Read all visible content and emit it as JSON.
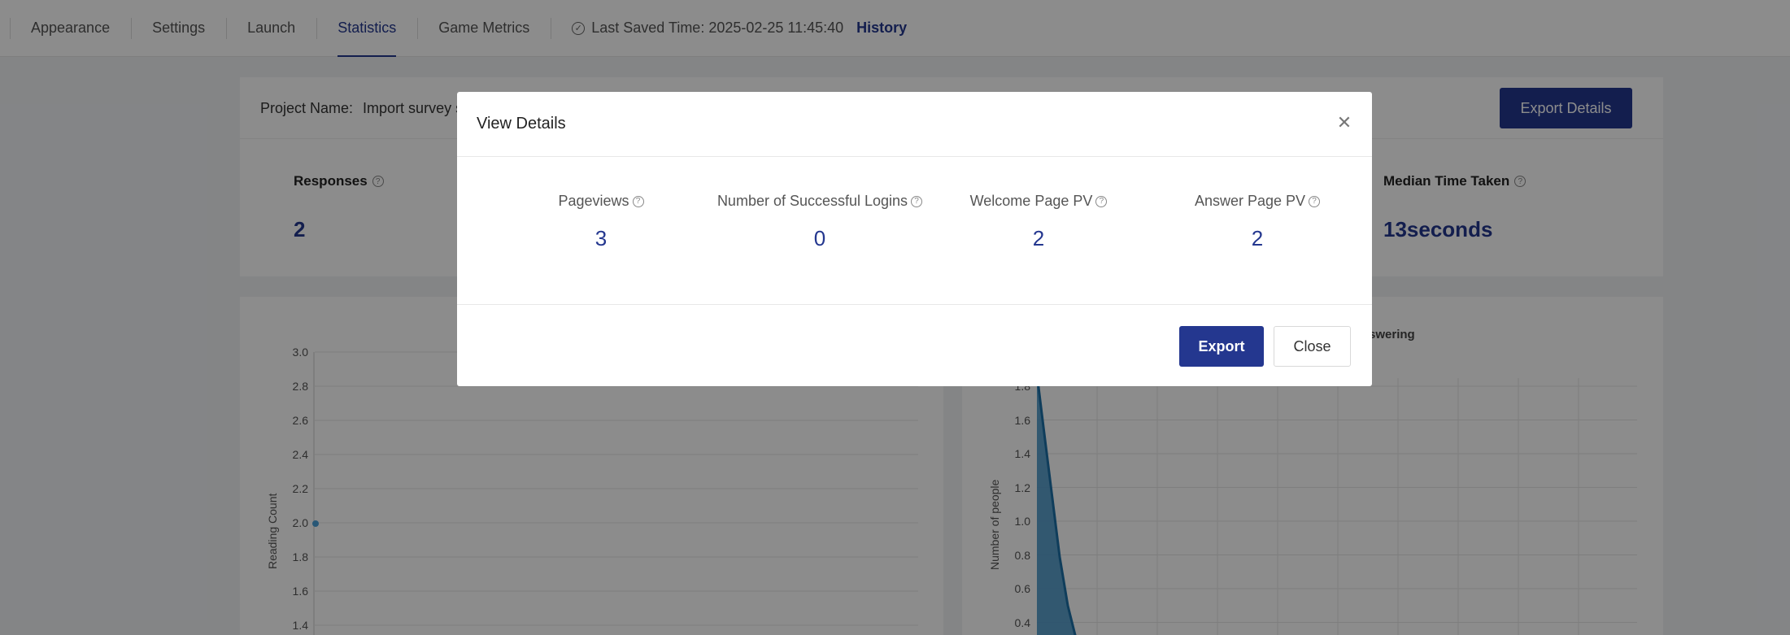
{
  "nav": {
    "tabs": [
      {
        "label": "Appearance"
      },
      {
        "label": "Settings"
      },
      {
        "label": "Launch"
      },
      {
        "label": "Statistics"
      },
      {
        "label": "Game Metrics"
      }
    ],
    "active_tab": "Statistics",
    "saved_text": "Last Saved Time: 2025-02-25 11:45:40",
    "history_label": "History"
  },
  "project": {
    "name_label": "Project Name:",
    "name_value": "Import survey s",
    "export_details_label": "Export Details"
  },
  "stats": {
    "responses_label": "Responses",
    "responses_value": "2",
    "median_label": "Median Time Taken",
    "median_value": "13seconds"
  },
  "left_chart": {
    "ylabel": "Reading Count",
    "yticks": [
      "3.0",
      "2.8",
      "2.6",
      "2.4",
      "2.2",
      "2.0",
      "1.8",
      "1.6",
      "1.4"
    ]
  },
  "right_chart": {
    "title_fragment": "swering",
    "ylabel": "Number of people",
    "yticks": [
      "1.8",
      "1.6",
      "1.4",
      "1.2",
      "1.0",
      "0.8",
      "0.6",
      "0.4"
    ]
  },
  "modal": {
    "title": "View Details",
    "metrics": [
      {
        "label": "Pageviews",
        "value": "3"
      },
      {
        "label": "Number of Successful Logins",
        "value": "0"
      },
      {
        "label": "Welcome Page PV",
        "value": "2"
      },
      {
        "label": "Answer Page PV",
        "value": "2"
      }
    ],
    "export_label": "Export",
    "close_label": "Close"
  },
  "colors": {
    "accent": "#24378f",
    "overlay": "rgba(0,0,0,0.45)"
  }
}
